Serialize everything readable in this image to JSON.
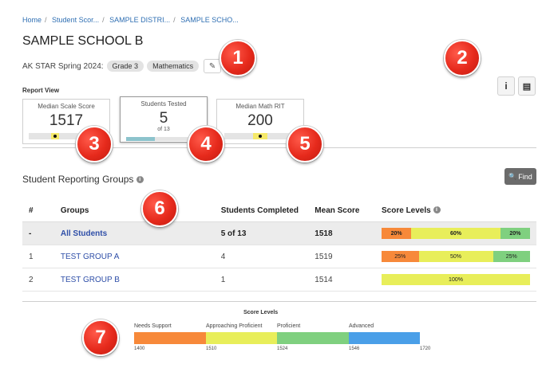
{
  "breadcrumb": [
    "Home",
    "Student Scor...",
    "SAMPLE DISTRI...",
    "SAMPLE SCHO..."
  ],
  "school_name": "SAMPLE SCHOOL B",
  "assessment": "AK STAR Spring 2024:",
  "chips": [
    "Grade 3",
    "Mathematics"
  ],
  "edit_icon": "✎",
  "header_icons": {
    "info": "i",
    "pdf": "▤"
  },
  "report_view": {
    "label": "Report View",
    "cards": [
      {
        "title": "Median Scale Score",
        "value": "1517",
        "sub": "",
        "indicator_fraction": 0.3
      },
      {
        "title": "Students Tested",
        "value": "5",
        "sub": "of 13",
        "indicator_fraction": 0.38
      },
      {
        "title": "Median Math RIT",
        "value": "200",
        "sub": "",
        "indicator_fraction": 0.5
      }
    ]
  },
  "section_title": "Student Reporting Groups",
  "info_glyph": "i",
  "find_button": {
    "icon": "🔍",
    "label": "Find"
  },
  "table": {
    "headers": [
      "#",
      "Groups",
      "Students Completed",
      "Mean Score",
      "Score Levels"
    ],
    "rows": [
      {
        "num": "-",
        "group": "All Students",
        "completed": "5 of 13",
        "mean": "1518",
        "levels": [
          "20%",
          "60%",
          "20%"
        ]
      },
      {
        "num": "1",
        "group": "TEST GROUP A",
        "completed": "4",
        "mean": "1519",
        "levels": [
          "25%",
          "50%",
          "25%"
        ]
      },
      {
        "num": "2",
        "group": "TEST GROUP B",
        "completed": "1",
        "mean": "1514",
        "levels": [
          "100%"
        ]
      }
    ]
  },
  "score_levels_legend": {
    "title": "Score Levels",
    "levels": [
      {
        "name": "Needs Support",
        "color": "#f7893a"
      },
      {
        "name": "Approaching Proficient",
        "color": "#e8ee5a"
      },
      {
        "name": "Proficient",
        "color": "#7fd07f"
      },
      {
        "name": "Advanced",
        "color": "#4a9fe8"
      }
    ],
    "ticks": [
      "1400",
      "1510",
      "1524",
      "1546",
      "1720"
    ]
  },
  "callouts": [
    "1",
    "2",
    "3",
    "4",
    "5",
    "6",
    "7"
  ],
  "colors": {
    "needs_support": "#f7893a",
    "approaching": "#e8ee5a",
    "proficient": "#7fd07f",
    "advanced": "#4a9fe8",
    "callout": "#e62a1c"
  }
}
